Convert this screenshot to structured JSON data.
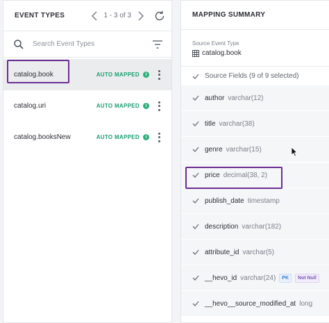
{
  "left": {
    "title": "EVENT TYPES",
    "pager": "1 - 3 of 3",
    "search_placeholder": "Search Event Types",
    "events": [
      {
        "name": "catalog.book",
        "badge": "AUTO MAPPED"
      },
      {
        "name": "catalog.uri",
        "badge": "AUTO MAPPED"
      },
      {
        "name": "catalog.booksNew",
        "badge": "AUTO MAPPED"
      }
    ]
  },
  "right": {
    "title": "MAPPING SUMMARY",
    "source_label": "Source Event Type",
    "source_value": "catalog.book",
    "fields_header": "Source Fields (9 of 9 selected)",
    "fields": [
      {
        "name": "author",
        "type": "varchar(12)"
      },
      {
        "name": "title",
        "type": "varchar(38)"
      },
      {
        "name": "genre",
        "type": "varchar(15)"
      },
      {
        "name": "price",
        "type": "decimal(38, 2)"
      },
      {
        "name": "publish_date",
        "type": "timestamp"
      },
      {
        "name": "description",
        "type": "varchar(182)"
      },
      {
        "name": "attribute_id",
        "type": "varchar(5)"
      },
      {
        "name": "__hevo_id",
        "type": "varchar(24)",
        "tags": [
          "PK",
          "Not Null"
        ]
      },
      {
        "name": "__hevo__source_modified_at",
        "type": "long"
      }
    ]
  },
  "colors": {
    "accent_highlight": "#6b2c91",
    "auto_mapped_green": "#1a9e6e"
  }
}
